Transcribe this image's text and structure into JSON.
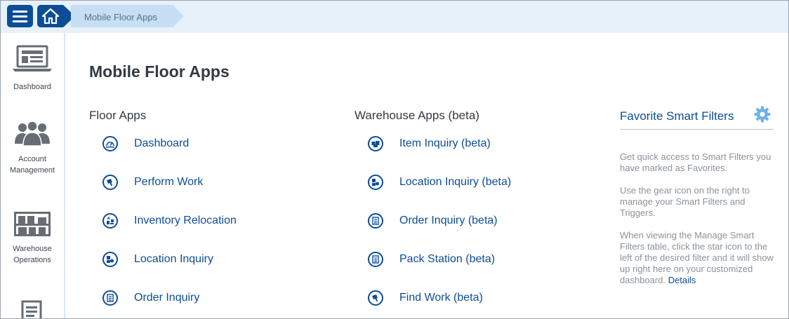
{
  "breadcrumb": {
    "current": "Mobile Floor Apps"
  },
  "sidebar": {
    "items": [
      {
        "label": "Dashboard",
        "icon": "laptop-dashboard-icon"
      },
      {
        "label": "Account Management",
        "label_line1": "Account",
        "label_line2": "Management",
        "icon": "users-icon"
      },
      {
        "label": "Warehouse Operations",
        "label_line1": "Warehouse",
        "label_line2": "Operations",
        "icon": "warehouse-shelf-icon"
      },
      {
        "label": "",
        "icon": "document-icon"
      }
    ]
  },
  "main": {
    "title": "Mobile Floor Apps",
    "floor_apps": {
      "title": "Floor Apps",
      "items": [
        {
          "label": "Dashboard",
          "icon": "dashboard-gauge-icon"
        },
        {
          "label": "Perform Work",
          "icon": "scanner-icon"
        },
        {
          "label": "Inventory Relocation",
          "icon": "relocation-icon"
        },
        {
          "label": "Location Inquiry",
          "icon": "location-icon"
        },
        {
          "label": "Order Inquiry",
          "icon": "order-icon"
        }
      ]
    },
    "warehouse_apps": {
      "title": "Warehouse Apps (beta)",
      "items": [
        {
          "label": "Item Inquiry (beta)",
          "icon": "item-boxes-icon"
        },
        {
          "label": "Location Inquiry (beta)",
          "icon": "location-icon"
        },
        {
          "label": "Order Inquiry (beta)",
          "icon": "order-icon"
        },
        {
          "label": "Pack Station (beta)",
          "icon": "pack-station-icon"
        },
        {
          "label": "Find Work (beta)",
          "icon": "scanner-icon"
        }
      ]
    }
  },
  "favorites": {
    "title": "Favorite Smart Filters",
    "p1": "Get quick access to Smart Filters you have marked as Favorites.",
    "p2": "Use the gear icon on the right to manage your Smart Filters and Triggers.",
    "p3": "When viewing the Manage Smart Filters table, click the star icon to the left of the desired filter and it will show up right here on your customized dashboard.",
    "details_link": "Details"
  },
  "colors": {
    "brand_blue": "#0d4d96",
    "topbar_bg": "#e6f1fa",
    "breadcrumb_bg": "#c6dff2",
    "gear_blue": "#6fb0e8"
  }
}
